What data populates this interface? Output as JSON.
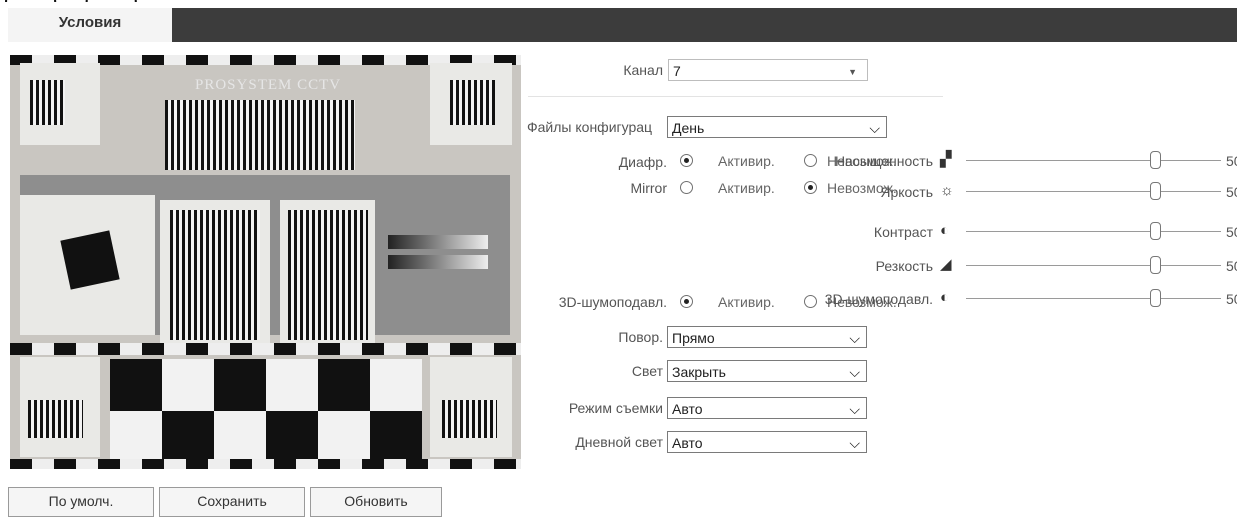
{
  "top_caption": "(... ...) ... (... ...)",
  "header": {
    "tab_label": "Условия"
  },
  "preview": {
    "logo_text": "PROSYSTEM CCTV"
  },
  "form": {
    "channel": {
      "label": "Канал",
      "value": "7"
    },
    "config_files": {
      "label": "Файлы конфигурац",
      "value": "День"
    },
    "iris": {
      "label": "Диафр.",
      "option_on": "Активир.",
      "option_off": "Невозмож.",
      "selected": "Активир."
    },
    "mirror": {
      "label": "Mirror",
      "option_on": "Активир.",
      "option_off": "Невозмож.",
      "selected": "Невозмож."
    },
    "dnr_3d": {
      "label": "3D-шумоподавл.",
      "option_on": "Активир.",
      "option_off": "Невозмож.",
      "selected": "Активир."
    },
    "rotation": {
      "label": "Повор.",
      "value": "Прямо"
    },
    "light": {
      "label": "Свет",
      "value": "Закрыть"
    },
    "shooting_mode": {
      "label": "Режим съемки",
      "value": "Авто"
    },
    "daylight": {
      "label": "Дневной свет",
      "value": "Авто"
    }
  },
  "sliders": [
    {
      "label": "Насыщенность",
      "icon": "saturation-icon",
      "value": "50"
    },
    {
      "label": "Яркость",
      "icon": "brightness-icon",
      "value": "50"
    },
    {
      "label": "Контраст",
      "icon": "contrast-icon",
      "value": "50"
    },
    {
      "label": "Резкость",
      "icon": "sharpness-icon",
      "value": "50"
    },
    {
      "label": "3D-шумоподавл.",
      "icon": "noise-reduction-icon",
      "value": "50"
    }
  ],
  "buttons": {
    "default": "По умолч.",
    "save": "Сохранить",
    "refresh": "Обновить"
  },
  "colors": {
    "header_bg": "#3c3c3c",
    "tab_bg": "#f4f4f4"
  }
}
